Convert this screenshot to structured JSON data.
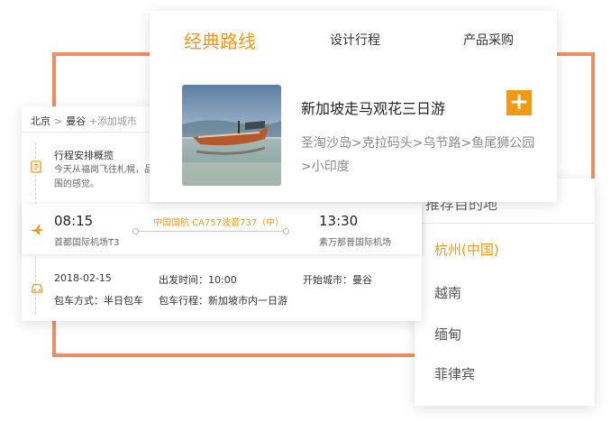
{
  "routes": {
    "tabs": [
      {
        "label": "经典路线"
      },
      {
        "label": "设计行程"
      },
      {
        "label": "产品采购"
      }
    ],
    "item": {
      "title": "新加坡走马观花三日游",
      "description": "圣淘沙岛>克拉码头>乌节路>鱼尾狮公园>小印度",
      "add_label": "+"
    }
  },
  "itinerary": {
    "breadcrumb": {
      "city1": "北京",
      "sep": ">",
      "city2": "曼谷",
      "add": "+添加城市"
    },
    "overview": {
      "title": "行程安排概揽",
      "text_line1": "今天从福岗飞往札幌，品尝",
      "text_line2": "围的感觉。"
    },
    "flight": {
      "depart_time": "08:15",
      "depart_airport": "首都国际机场T3",
      "flight_no": "中国国航  CA757波音737（中）",
      "arrive_time": "13:30",
      "arrive_airport": "素万那普国际机场"
    },
    "charter": {
      "date": "2018-02-15",
      "depart_time": "出发时间：10:00",
      "start_city": "开始城市：曼谷",
      "mode": "包车方式：半日包车",
      "route": "包车行程：新加坡市内一日游"
    }
  },
  "destinations": {
    "header": "推荐目的地",
    "items": [
      {
        "label": "杭州(中国)",
        "active": true
      },
      {
        "label": "越南",
        "active": false
      },
      {
        "label": "缅甸",
        "active": false
      },
      {
        "label": "菲律宾",
        "active": false
      }
    ]
  },
  "colors": {
    "accent": "#f39a12",
    "frame": "#ef8e62"
  }
}
